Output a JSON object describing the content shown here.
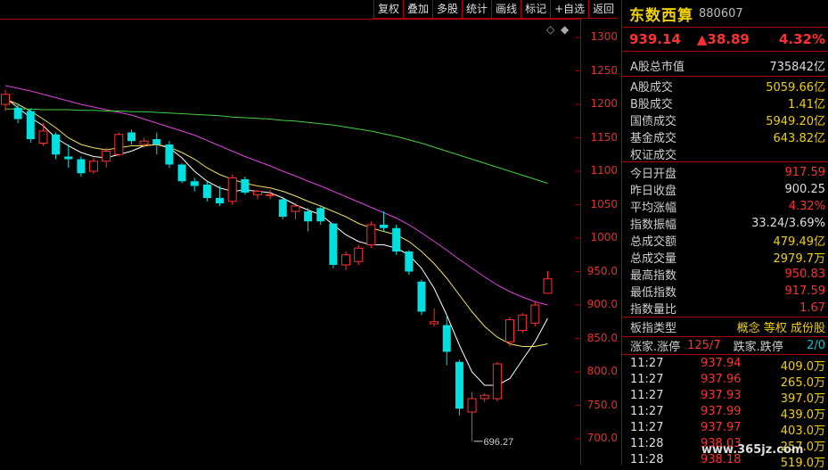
{
  "toolbar": {
    "items": [
      "复权",
      "叠加",
      "多股",
      "统计",
      "画线",
      "标记",
      "+自选",
      "返回"
    ]
  },
  "y_ticks": [
    "1300",
    "1250",
    "1200",
    "1150",
    "1100",
    "1050",
    "1000",
    "950.0",
    "900.0",
    "850.0",
    "800.0",
    "750.0",
    "700.0"
  ],
  "chart_data": {
    "type": "candlestick",
    "ylim": [
      675,
      1320
    ],
    "low_annotation": "696.27",
    "candles": [
      {
        "o": 1200,
        "c": 1215,
        "h": 1222,
        "l": 1190
      },
      {
        "o": 1195,
        "c": 1178,
        "h": 1200,
        "l": 1172
      },
      {
        "o": 1190,
        "c": 1148,
        "h": 1194,
        "l": 1143
      },
      {
        "o": 1142,
        "c": 1160,
        "h": 1172,
        "l": 1138
      },
      {
        "o": 1155,
        "c": 1125,
        "h": 1158,
        "l": 1118
      },
      {
        "o": 1122,
        "c": 1118,
        "h": 1140,
        "l": 1105
      },
      {
        "o": 1118,
        "c": 1097,
        "h": 1122,
        "l": 1092
      },
      {
        "o": 1100,
        "c": 1115,
        "h": 1120,
        "l": 1096
      },
      {
        "o": 1115,
        "c": 1130,
        "h": 1135,
        "l": 1105
      },
      {
        "o": 1125,
        "c": 1155,
        "h": 1158,
        "l": 1122
      },
      {
        "o": 1158,
        "c": 1145,
        "h": 1162,
        "l": 1140
      },
      {
        "o": 1140,
        "c": 1145,
        "h": 1150,
        "l": 1135
      },
      {
        "o": 1148,
        "c": 1140,
        "h": 1158,
        "l": 1125
      },
      {
        "o": 1140,
        "c": 1110,
        "h": 1145,
        "l": 1105
      },
      {
        "o": 1110,
        "c": 1085,
        "h": 1112,
        "l": 1082
      },
      {
        "o": 1085,
        "c": 1078,
        "h": 1090,
        "l": 1070
      },
      {
        "o": 1080,
        "c": 1060,
        "h": 1085,
        "l": 1055
      },
      {
        "o": 1060,
        "c": 1052,
        "h": 1078,
        "l": 1048
      },
      {
        "o": 1055,
        "c": 1090,
        "h": 1095,
        "l": 1050
      },
      {
        "o": 1088,
        "c": 1068,
        "h": 1092,
        "l": 1065
      },
      {
        "o": 1065,
        "c": 1070,
        "h": 1072,
        "l": 1058
      },
      {
        "o": 1065,
        "c": 1065,
        "h": 1072,
        "l": 1058
      },
      {
        "o": 1058,
        "c": 1032,
        "h": 1062,
        "l": 1028
      },
      {
        "o": 1040,
        "c": 1048,
        "h": 1052,
        "l": 1028
      },
      {
        "o": 1040,
        "c": 1025,
        "h": 1045,
        "l": 1010
      },
      {
        "o": 1045,
        "c": 1025,
        "h": 1048,
        "l": 1020
      },
      {
        "o": 1022,
        "c": 960,
        "h": 1022,
        "l": 955
      },
      {
        "o": 960,
        "c": 975,
        "h": 980,
        "l": 952
      },
      {
        "o": 965,
        "c": 985,
        "h": 990,
        "l": 960
      },
      {
        "o": 990,
        "c": 1020,
        "h": 1025,
        "l": 985
      },
      {
        "o": 1020,
        "c": 1015,
        "h": 1040,
        "l": 1010
      },
      {
        "o": 1015,
        "c": 980,
        "h": 1020,
        "l": 975
      },
      {
        "o": 980,
        "c": 950,
        "h": 982,
        "l": 945
      },
      {
        "o": 935,
        "c": 890,
        "h": 938,
        "l": 885
      },
      {
        "o": 872,
        "c": 875,
        "h": 895,
        "l": 868
      },
      {
        "o": 870,
        "c": 830,
        "h": 885,
        "l": 810
      },
      {
        "o": 815,
        "c": 745,
        "h": 818,
        "l": 735
      },
      {
        "o": 740,
        "c": 760,
        "h": 770,
        "l": 696.27
      },
      {
        "o": 760,
        "c": 765,
        "h": 768,
        "l": 755
      },
      {
        "o": 760,
        "c": 812,
        "h": 815,
        "l": 756
      },
      {
        "o": 845,
        "c": 878,
        "h": 882,
        "l": 838
      },
      {
        "o": 862,
        "c": 885,
        "h": 888,
        "l": 858
      },
      {
        "o": 873,
        "c": 900,
        "h": 905,
        "l": 868
      },
      {
        "o": 917.59,
        "c": 939.14,
        "h": 950.83,
        "l": 917.59
      }
    ],
    "ma_lines": [
      {
        "color": "#ffffff",
        "values": [
          1210,
          1195,
          1180,
          1168,
          1150,
          1138,
          1128,
          1122,
          1120,
          1125,
          1130,
          1138,
          1140,
          1135,
          1120,
          1100,
          1085,
          1075,
          1070,
          1072,
          1070,
          1068,
          1060,
          1050,
          1042,
          1035,
          1020,
          1005,
          995,
          990,
          990,
          985,
          975,
          955,
          925,
          885,
          840,
          800,
          780,
          780,
          790,
          818,
          845,
          880
        ]
      },
      {
        "color": "#f0e060",
        "values": [
          1208,
          1200,
          1190,
          1178,
          1165,
          1150,
          1140,
          1135,
          1132,
          1135,
          1138,
          1138,
          1140,
          1136,
          1128,
          1118,
          1105,
          1095,
          1088,
          1082,
          1078,
          1075,
          1070,
          1063,
          1055,
          1048,
          1040,
          1032,
          1022,
          1015,
          1010,
          1005,
          995,
          980,
          962,
          940,
          915,
          890,
          868,
          852,
          842,
          838,
          838,
          842
        ]
      },
      {
        "color": "#e040e0",
        "values": [
          1228,
          1224,
          1220,
          1215,
          1210,
          1205,
          1200,
          1196,
          1192,
          1188,
          1184,
          1178,
          1172,
          1166,
          1160,
          1154,
          1146,
          1138,
          1130,
          1122,
          1115,
          1108,
          1100,
          1093,
          1085,
          1078,
          1070,
          1062,
          1054,
          1046,
          1038,
          1030,
          1020,
          1008,
          995,
          982,
          968,
          955,
          942,
          930,
          920,
          912,
          905,
          900
        ]
      },
      {
        "color": "#40d040",
        "values": [
          1193,
          1193,
          1193,
          1192,
          1192,
          1192,
          1191,
          1191,
          1190,
          1190,
          1189,
          1189,
          1188,
          1187,
          1186,
          1185,
          1184,
          1183,
          1181,
          1180,
          1179,
          1178,
          1176,
          1175,
          1173,
          1171,
          1169,
          1166,
          1163,
          1160,
          1156,
          1152,
          1147,
          1142,
          1136,
          1130,
          1124,
          1118,
          1112,
          1106,
          1100,
          1094,
          1088,
          1082
        ]
      }
    ]
  },
  "panel": {
    "name": "东数西算",
    "code": "880607",
    "price": "939.14",
    "change": "▲38.89",
    "pct": "4.32%",
    "mkt_label": "A股总市值",
    "mkt_val": "735842亿",
    "turnover": [
      {
        "label": "A股成交",
        "value": "5059.66亿"
      },
      {
        "label": "B股成交",
        "value": "1.41亿"
      },
      {
        "label": "国债成交",
        "value": "5949.20亿"
      },
      {
        "label": "基金成交",
        "value": "643.82亿"
      },
      {
        "label": "权证成交",
        "value": ""
      }
    ],
    "stats": [
      {
        "label": "今日开盘",
        "value": "917.59",
        "cls": "r"
      },
      {
        "label": "昨日收盘",
        "value": "900.25",
        "cls": "w"
      },
      {
        "label": "平均涨幅",
        "value": "4.32%",
        "cls": "r"
      },
      {
        "label": "指数振幅",
        "value": "33.24/3.69%",
        "cls": "w"
      },
      {
        "label": "总成交额",
        "value": "479.49亿",
        "cls": "y"
      },
      {
        "label": "总成交量",
        "value": "2979.7万",
        "cls": "y"
      },
      {
        "label": "最高指数",
        "value": "950.83",
        "cls": "r"
      },
      {
        "label": "最低指数",
        "value": "917.59",
        "cls": "r"
      },
      {
        "label": "指数量比",
        "value": "1.67",
        "cls": "r"
      }
    ],
    "sector_label": "板指类型",
    "sector_val": "概念 等权 成份股",
    "adv_label": "涨家.涨停",
    "adv_val": "125/7",
    "dec_label": "跌家.跌停",
    "dec_val": "2/0",
    "ticks": [
      {
        "t": "11:27",
        "p": "937.94",
        "v": "409.0万"
      },
      {
        "t": "11:27",
        "p": "937.96",
        "v": "265.0万"
      },
      {
        "t": "11:27",
        "p": "937.93",
        "v": "397.0万"
      },
      {
        "t": "11:27",
        "p": "937.99",
        "v": "439.0万"
      },
      {
        "t": "11:27",
        "p": "937.97",
        "v": "403.0万"
      },
      {
        "t": "11:28",
        "p": "938.03",
        "v": "257.0万"
      },
      {
        "t": "11:28",
        "p": "938.18",
        "v": "519.0万"
      }
    ],
    "watermark": "www.365jz.com"
  }
}
